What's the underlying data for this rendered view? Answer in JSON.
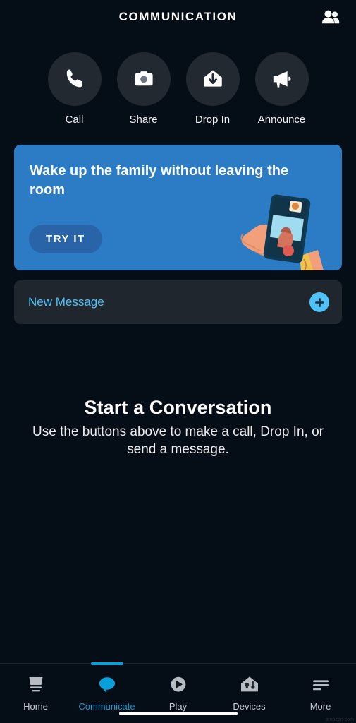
{
  "header": {
    "title": "COMMUNICATION",
    "contacts_icon": "contacts-people-icon"
  },
  "quick_actions": [
    {
      "label": "Call",
      "icon": "phone-icon"
    },
    {
      "label": "Share",
      "icon": "camera-icon"
    },
    {
      "label": "Drop In",
      "icon": "house-down-arrow-icon"
    },
    {
      "label": "Announce",
      "icon": "megaphone-icon"
    }
  ],
  "promo": {
    "title": "Wake up the family without leaving the room",
    "cta_label": "TRY IT",
    "art": "hand-holding-phone-illustration",
    "bg_color": "#2B7CC4",
    "cta_color": "#2A64A8"
  },
  "new_message": {
    "label": "New Message",
    "plus_icon": "plus-circle-icon",
    "accent_color": "#4FC3F7"
  },
  "empty_state": {
    "title": "Start a Conversation",
    "subtitle": "Use the buttons above to make a call, Drop In, or send a message."
  },
  "bottom_nav": {
    "active_color": "#0A9FD8",
    "items": [
      {
        "label": "Home",
        "icon": "echo-device-icon",
        "active": false
      },
      {
        "label": "Communicate",
        "icon": "speech-bubble-icon",
        "active": true
      },
      {
        "label": "Play",
        "icon": "play-circle-icon",
        "active": false
      },
      {
        "label": "Devices",
        "icon": "smart-home-icon",
        "active": false
      },
      {
        "label": "More",
        "icon": "hamburger-menu-icon",
        "active": false
      }
    ]
  },
  "system": {
    "home_indicator": "home-indicator-bar",
    "watermark": "amazon.com"
  }
}
